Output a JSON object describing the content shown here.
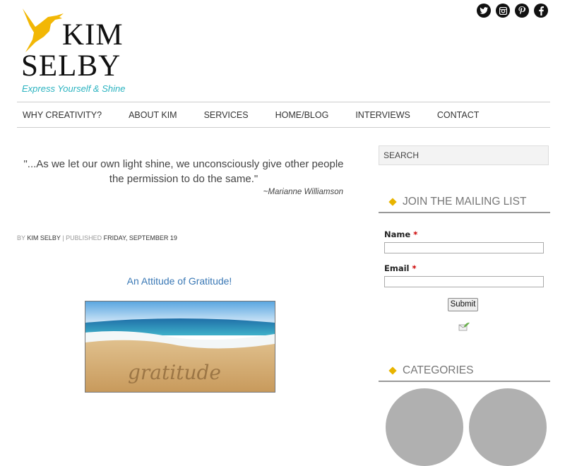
{
  "brand": {
    "name_line1": "KIM",
    "name_line2": "SELBY",
    "tagline": "Express Yourself & Shine",
    "accent_color": "#F2B705",
    "tagline_color": "#2BB3C0"
  },
  "social": [
    {
      "name": "twitter",
      "glyph": "t"
    },
    {
      "name": "instagram",
      "glyph": "◘"
    },
    {
      "name": "pinterest",
      "glyph": "p"
    },
    {
      "name": "facebook",
      "glyph": "f"
    }
  ],
  "nav": {
    "items": [
      "WHY CREATIVITY?",
      "ABOUT KIM",
      "SERVICES",
      "HOME/BLOG",
      "INTERVIEWS",
      "CONTACT"
    ]
  },
  "quote": {
    "text": "\"...As we let our own light shine, we unconsciously give other people the permission to do the same.\"",
    "author": "~Marianne Williamson"
  },
  "post": {
    "by_label": "BY",
    "author": "KIM SELBY",
    "sep": "|",
    "published_label": "PUBLISHED",
    "date": "FRIDAY, SEPTEMBER 19",
    "title": "An Attitude of Gratitude!",
    "image_word": "gratitude"
  },
  "sidebar": {
    "search_placeholder": "SEARCH",
    "mailing_title": "JOIN THE MAILING LIST",
    "name_label": "Name",
    "email_label": "Email",
    "required_mark": "*",
    "submit_label": "Submit",
    "categories_title": "CATEGORIES"
  }
}
